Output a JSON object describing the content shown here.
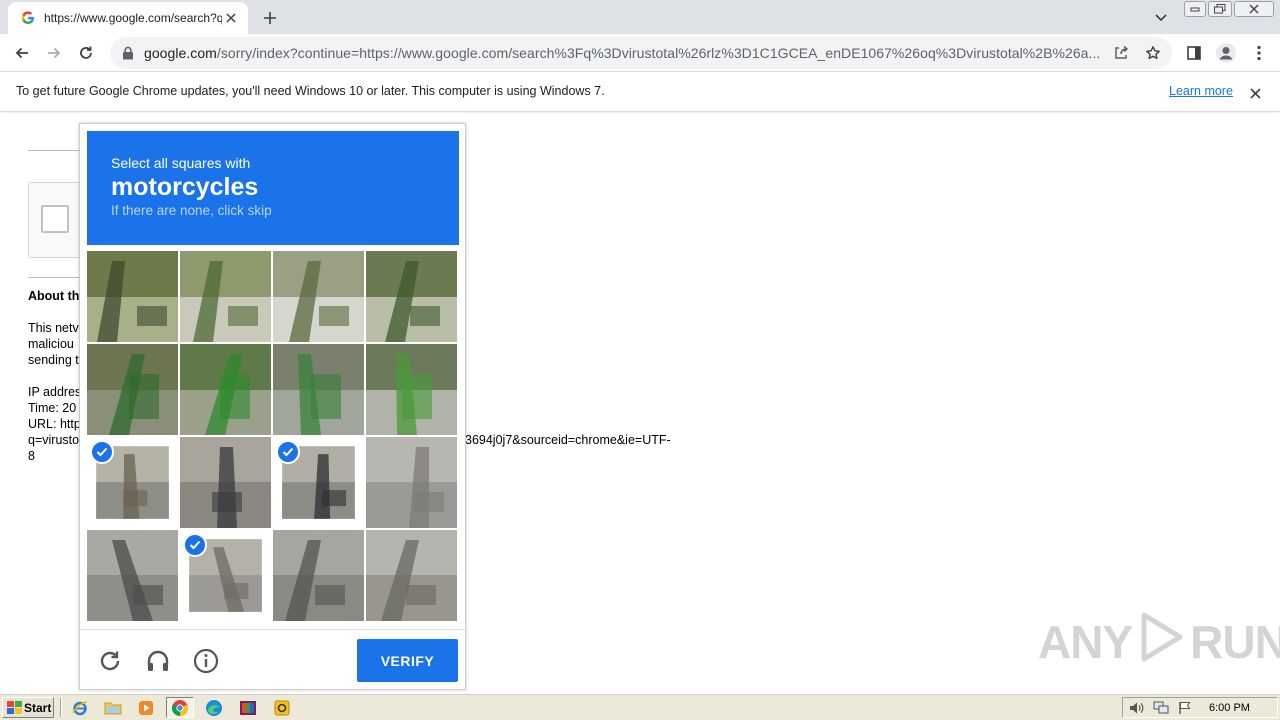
{
  "browser": {
    "tab": {
      "title": "https://www.google.com/search?q=vi"
    },
    "window_controls": {
      "min": "–",
      "max": "⧉",
      "close": "✕"
    },
    "address": {
      "host": "google.com",
      "path": "/sorry/index?continue=https://www.google.com/search%3Fq%3Dvirustotal%26rlz%3D1C1GCEA_enDE1067%26oq%3Dvirustotal%2B%26a..."
    },
    "icons": [
      "back-arrow-icon",
      "forward-arrow-icon",
      "reload-icon",
      "lock-icon",
      "share-icon",
      "bookmark-star-icon",
      "side-panel-icon",
      "profile-icon",
      "kebab-menu-icon"
    ]
  },
  "infobar": {
    "message": "To get future Google Chrome updates, you'll need Windows 10 or later. This computer is using Windows 7.",
    "link": "Learn more"
  },
  "page": {
    "about_heading": "About th",
    "lines": [
      "This netv",
      "maliciou",
      "sending t",
      "IP addres",
      "Time: 20",
      "URL: http",
      "q=virusto",
      "8"
    ],
    "url_tail": "3694j0j7&sourceid=chrome&ie=UTF-"
  },
  "captcha": {
    "intro": "Select all squares with",
    "target": "motorcycles",
    "hint": "If there are none, click skip",
    "tiles": [
      {
        "row": 0,
        "col": 0,
        "selected": false
      },
      {
        "row": 0,
        "col": 1,
        "selected": false
      },
      {
        "row": 0,
        "col": 2,
        "selected": false
      },
      {
        "row": 0,
        "col": 3,
        "selected": false
      },
      {
        "row": 1,
        "col": 0,
        "selected": false
      },
      {
        "row": 1,
        "col": 1,
        "selected": false
      },
      {
        "row": 1,
        "col": 2,
        "selected": false
      },
      {
        "row": 1,
        "col": 3,
        "selected": false
      },
      {
        "row": 2,
        "col": 0,
        "selected": true
      },
      {
        "row": 2,
        "col": 1,
        "selected": false
      },
      {
        "row": 2,
        "col": 2,
        "selected": true
      },
      {
        "row": 2,
        "col": 3,
        "selected": false
      },
      {
        "row": 3,
        "col": 0,
        "selected": false
      },
      {
        "row": 3,
        "col": 1,
        "selected": true
      },
      {
        "row": 3,
        "col": 2,
        "selected": false
      },
      {
        "row": 3,
        "col": 3,
        "selected": false
      }
    ],
    "footer_icons": [
      "reload-icon",
      "headphones-icon",
      "info-icon"
    ],
    "verify_label": "VERIFY",
    "colors": {
      "accent": "#1a73e8",
      "hint": "#bcd4f6"
    }
  },
  "watermark": {
    "left": "ANY",
    "right": "RUN"
  },
  "taskbar": {
    "start_label": "Start",
    "apps": [
      "ie-icon",
      "explorer-folder-icon",
      "media-player-icon",
      "chrome-icon",
      "edge-icon",
      "winrar-icon",
      "norton-icon"
    ],
    "tray_icons": [
      "speaker-icon",
      "network-icon",
      "flag-icon"
    ],
    "clock": "6:00 PM"
  }
}
